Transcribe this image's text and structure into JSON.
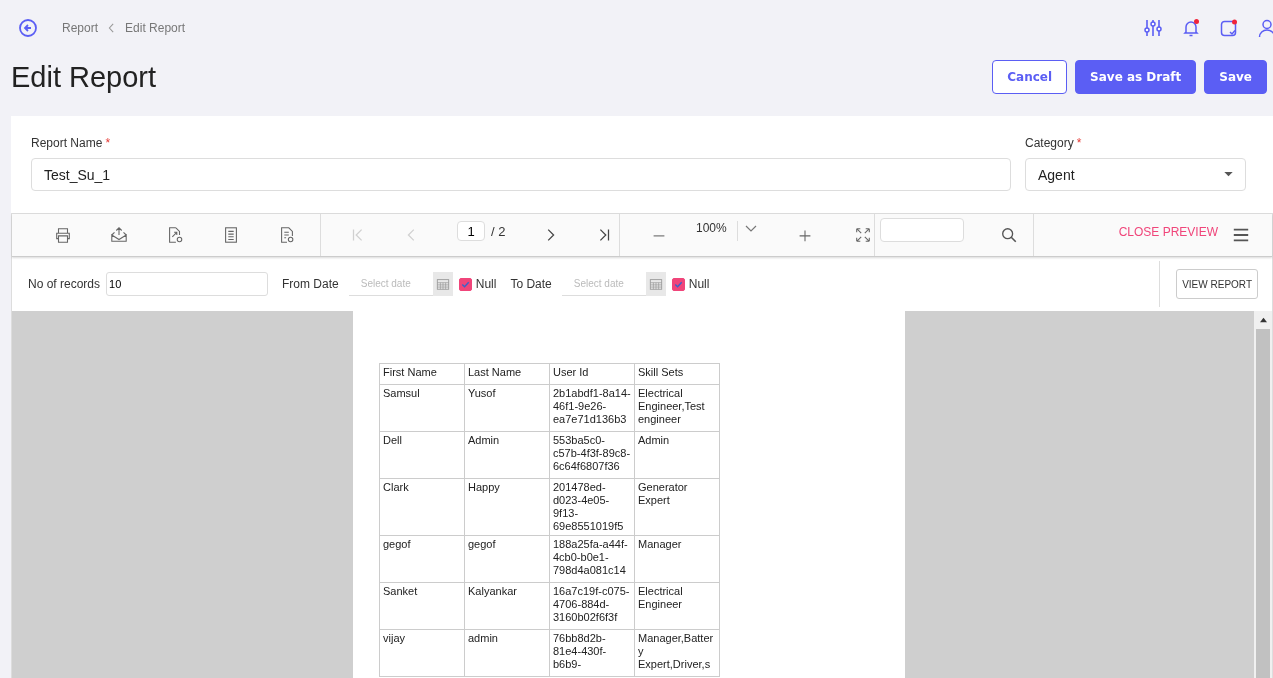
{
  "breadcrumb": [
    {
      "label": "Report"
    },
    {
      "label": "Edit Report"
    }
  ],
  "title": "Edit Report",
  "actions": [
    {
      "label": "Cancel",
      "kind": "outline"
    },
    {
      "label": "Save as Draft",
      "kind": "primary"
    },
    {
      "label": "Save",
      "kind": "primary"
    }
  ],
  "form": {
    "report_name": {
      "label": "Report Name",
      "required_mark": "*",
      "value": "Test_Su_1"
    },
    "category": {
      "label": "Category",
      "required_mark": "*",
      "value": "Agent"
    }
  },
  "viewer": {
    "nav": [
      {
        "kind": "first",
        "disabled": true
      },
      {
        "kind": "prev",
        "disabled": true
      },
      {
        "kind": "next",
        "disabled": false
      },
      {
        "kind": "last",
        "disabled": false
      }
    ],
    "page": "1",
    "page_total": "/ 2",
    "zoom": "100%",
    "close_preview": "CLOSE PREVIEW",
    "params": {
      "records": {
        "label": "No of records",
        "value": "10"
      },
      "dates": [
        {
          "label": "From Date",
          "placeholder": "Select date",
          "null_label": "Null",
          "checked": true
        },
        {
          "label": "To Date",
          "placeholder": "Select date",
          "null_label": "Null",
          "checked": true
        }
      ],
      "view_report": "VIEW REPORT"
    },
    "table": {
      "columns": [
        "First Name",
        "Last Name",
        "User Id",
        "Skill Sets"
      ],
      "rows": [
        [
          "Samsul",
          "Yusof",
          "2b1abdf1-8a14-46f1-9e26-ea7e71d136b3",
          "Electrical Engineer,Test engineer"
        ],
        [
          "Dell",
          "Admin",
          "553ba5c0-c57b-4f3f-89c8-6c64f6807f36",
          "Admin"
        ],
        [
          "Clark",
          "Happy",
          "201478ed-d023-4e05-9f13-69e8551019f5",
          "Generator Expert"
        ],
        [
          "gegof",
          "gegof",
          "188a25fa-a44f-4cb0-b0e1-798d4a081c14",
          "Manager"
        ],
        [
          "Sanket",
          "Kalyankar",
          "16a7c19f-c075-4706-884d-3160b02f6f3f",
          "Electrical Engineer"
        ],
        [
          "vijay",
          "admin",
          "76bb8d2b-81e4-430f-b6b9-",
          "Manager,Battery Expert,Driver,s"
        ]
      ]
    }
  }
}
